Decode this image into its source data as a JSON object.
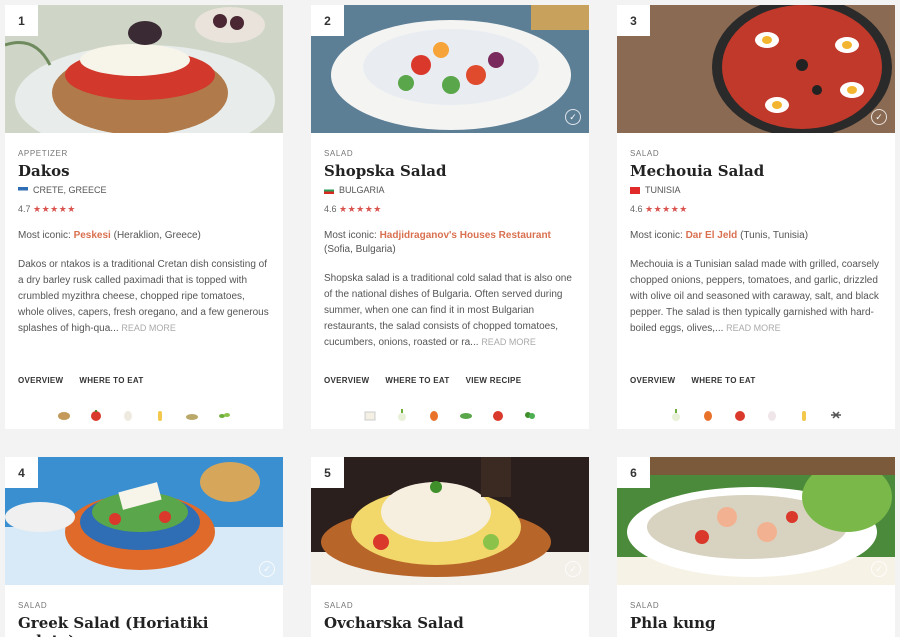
{
  "cards": [
    {
      "num": "1",
      "category": "APPETIZER",
      "title": "Dakos",
      "country": "CRETE, GREECE",
      "rating": "4.7",
      "stars": "★★★★★",
      "iconic_prefix": "Most iconic:",
      "iconic_rest": "Peskesi",
      "iconic_suffix": "(Heraklion, Greece)",
      "desc": "Dakos or ntakos is a traditional Cretan dish consisting of a dry barley rusk called paximadi that is topped with crumbled myzithra cheese, chopped ripe tomatoes, whole olives, capers, fresh oregano, and a few generous splashes of high-qua...",
      "read_more": "READ MORE",
      "links": [
        "OVERVIEW",
        "WHERE TO EAT"
      ]
    },
    {
      "num": "2",
      "category": "SALAD",
      "title": "Shopska Salad",
      "country": "BULGARIA",
      "rating": "4.6",
      "stars": "★★★★★",
      "iconic_prefix": "Most iconic:",
      "iconic_rest": "Hadjidraganov's Houses Restaurant",
      "iconic_suffix": "(Sofia, Bulgaria)",
      "desc": "Shopska salad is a traditional cold salad that is also one of the national dishes of Bulgaria. Often served during summer, when one can find it in most Bulgarian restaurants, the salad consists of chopped tomatoes, cucumbers, onions, roasted or ra...",
      "read_more": "READ MORE",
      "links": [
        "OVERVIEW",
        "WHERE TO EAT",
        "VIEW RECIPE"
      ]
    },
    {
      "num": "3",
      "category": "SALAD",
      "title": "Mechouia Salad",
      "country": "TUNISIA",
      "rating": "4.6",
      "stars": "★★★★★",
      "iconic_prefix": "Most iconic:",
      "iconic_rest": "Dar El Jeld",
      "iconic_suffix": "(Tunis, Tunisia)",
      "desc": "Mechouia is a Tunisian salad made with grilled, coarsely chopped onions, peppers, tomatoes, and garlic, drizzled with olive oil and seasoned with caraway, salt, and black pepper. The salad is then typically garnished with hard-boiled eggs, olives,...",
      "read_more": "READ MORE",
      "links": [
        "OVERVIEW",
        "WHERE TO EAT"
      ]
    },
    {
      "num": "4",
      "category": "SALAD",
      "title": "Greek Salad (Horiatiki salata)"
    },
    {
      "num": "5",
      "category": "SALAD",
      "title": "Ovcharska Salad"
    },
    {
      "num": "6",
      "category": "SALAD",
      "title": "Phla kung"
    }
  ],
  "colors": {
    "accent": "#d9704f",
    "stars": "#d9534f"
  }
}
